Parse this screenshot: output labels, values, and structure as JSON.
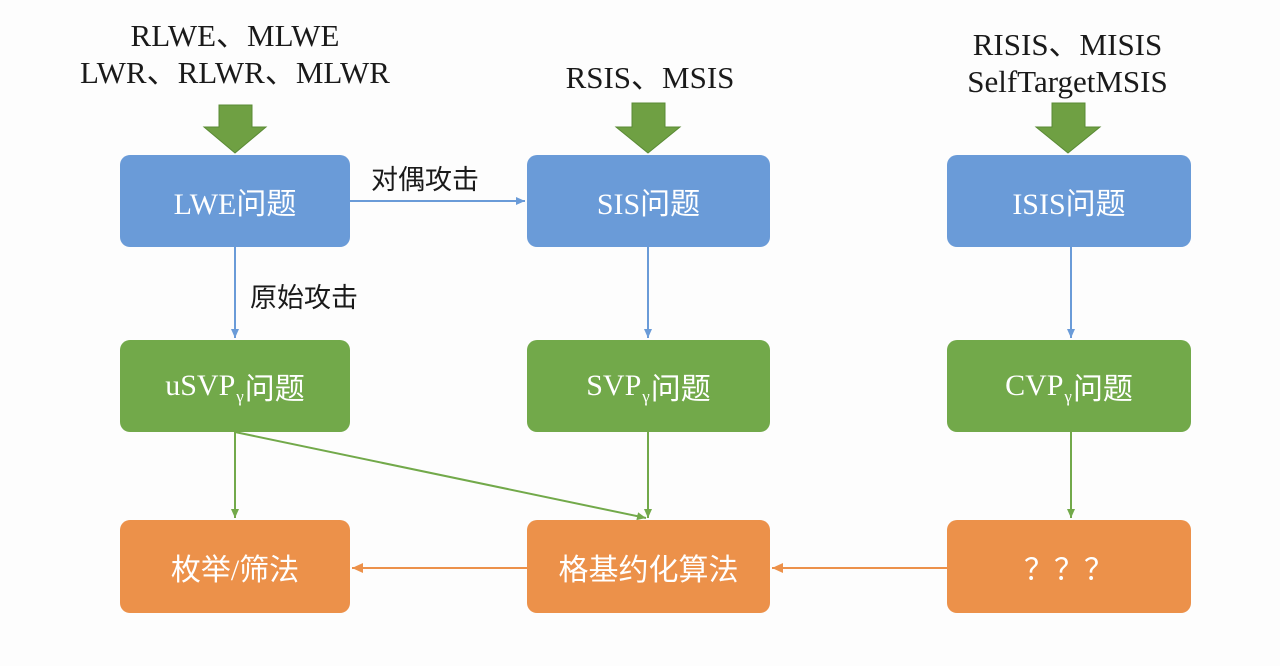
{
  "colors": {
    "blue": "#6a9bd8",
    "green": "#72a94a",
    "orange": "#ec914a",
    "blue_line": "#6a9bd8",
    "green_line": "#72a94a",
    "orange_line": "#ec914a",
    "big_arrow": "#6fa043"
  },
  "variants": {
    "lwe": {
      "line1": "RLWE、MLWE",
      "line2": "LWR、RLWR、MLWR"
    },
    "sis": {
      "line1": "RSIS、MSIS"
    },
    "isis": {
      "line1": "RISIS、MISIS",
      "line2": "SelfTargetMSIS"
    }
  },
  "nodes": {
    "lwe": {
      "label": "LWE问题"
    },
    "sis": {
      "label": "SIS问题"
    },
    "isis": {
      "label": "ISIS问题"
    },
    "usvp": {
      "prefix": "uSVP",
      "sub": "γ",
      "suffix": "问题"
    },
    "svp": {
      "prefix": "SVP",
      "sub": "γ",
      "suffix": "问题"
    },
    "cvp": {
      "prefix": "CVP",
      "sub": "γ",
      "suffix": "问题"
    },
    "enum": {
      "label": "枚举/筛法"
    },
    "reduction": {
      "label": "格基约化算法"
    },
    "unknown": {
      "label": "？？？"
    }
  },
  "edges": {
    "dual_attack_label": "对偶攻击",
    "primal_attack_label": "原始攻击"
  }
}
